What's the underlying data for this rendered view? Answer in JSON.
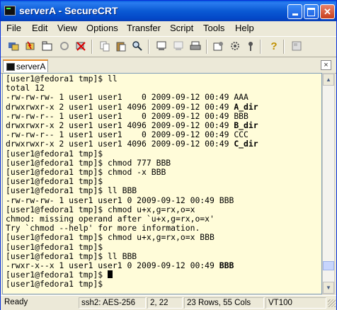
{
  "window": {
    "title": "serverA - SecureCRT"
  },
  "menu": [
    "File",
    "Edit",
    "View",
    "Options",
    "Transfer",
    "Script",
    "Tools",
    "Help"
  ],
  "toolbar_icons": [
    "connect-icon",
    "quick-connect-icon",
    "connect-in-tab-icon",
    "reconnect-icon",
    "disconnect-icon",
    "copy-icon",
    "paste-icon",
    "find-icon",
    "print-screen-icon",
    "print-selection-icon",
    "print-icon",
    "session-options-icon",
    "global-options-icon",
    "keymap-icon",
    "help-icon",
    "sftp-icon"
  ],
  "tab": {
    "label": "serverA",
    "close_glyph": "×"
  },
  "terminal": {
    "lines": [
      {
        "text": "[user1@fedora1 tmp]$ ll"
      },
      {
        "text": "total 12"
      },
      {
        "text": "-rw-rw-rw- 1 user1 user1    0 2009-09-12 00:49 AAA"
      },
      {
        "text": "drwxrwxr-x 2 user1 user1 4096 2009-09-12 00:49 ",
        "bold": "A_dir"
      },
      {
        "text": "-rw-rw-r-- 1 user1 user1    0 2009-09-12 00:49 BBB"
      },
      {
        "text": "drwxrwxr-x 2 user1 user1 4096 2009-09-12 00:49 ",
        "bold": "B_dir"
      },
      {
        "text": "-rw-rw-r-- 1 user1 user1    0 2009-09-12 00:49 CCC"
      },
      {
        "text": "drwxrwxr-x 2 user1 user1 4096 2009-09-12 00:49 ",
        "bold": "C_dir"
      },
      {
        "text": "[user1@fedora1 tmp]$"
      },
      {
        "text": "[user1@fedora1 tmp]$ chmod 777 BBB"
      },
      {
        "text": "[user1@fedora1 tmp]$ chmod -x BBB"
      },
      {
        "text": "[user1@fedora1 tmp]$"
      },
      {
        "text": "[user1@fedora1 tmp]$ ll BBB"
      },
      {
        "text": "-rw-rw-rw- 1 user1 user1 0 2009-09-12 00:49 BBB"
      },
      {
        "text": "[user1@fedora1 tmp]$ chmod u+x,g=rx,o=x"
      },
      {
        "text": "chmod: missing operand after `u+x,g=rx,o=x'"
      },
      {
        "text": "Try `chmod --help' for more information."
      },
      {
        "text": "[user1@fedora1 tmp]$ chmod u+x,g=rx,o=x BBB"
      },
      {
        "text": "[user1@fedora1 tmp]$"
      },
      {
        "text": "[user1@fedora1 tmp]$ ll BBB"
      },
      {
        "text": "-rwxr-x--x 1 user1 user1 0 2009-09-12 00:49 ",
        "bold": "BBB"
      },
      {
        "text": "[user1@fedora1 tmp]$",
        "cursor": true
      },
      {
        "text": "[user1@fedora1 tmp]$"
      }
    ]
  },
  "status": {
    "ready": "Ready",
    "cipher": "ssh2: AES-256",
    "position": "2,  22",
    "size": "23 Rows,  55 Cols",
    "terminal_type": "VT100"
  }
}
